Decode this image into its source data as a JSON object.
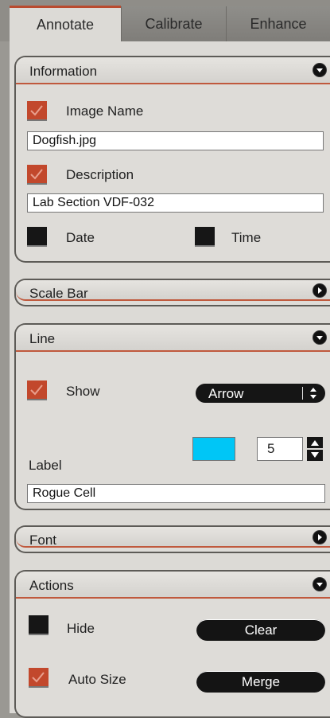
{
  "tabs": [
    {
      "label": "Annotate",
      "active": true
    },
    {
      "label": "Calibrate",
      "active": false
    },
    {
      "label": "Enhance",
      "active": false
    }
  ],
  "information": {
    "title": "Information",
    "image_name": {
      "label": "Image Name",
      "checked": true,
      "value": "Dogfish.jpg"
    },
    "description": {
      "label": "Description",
      "checked": true,
      "value": "Lab Section VDF-032"
    },
    "date": {
      "label": "Date",
      "checked": false
    },
    "time": {
      "label": "Time",
      "checked": false
    }
  },
  "scale_bar": {
    "title": "Scale Bar"
  },
  "line": {
    "title": "Line",
    "show": {
      "label": "Show",
      "checked": true
    },
    "style": {
      "value": "Arrow"
    },
    "color": "#00c6f6",
    "width": {
      "value": "5"
    },
    "label_text": {
      "label": "Label",
      "value": "Rogue Cell"
    }
  },
  "font": {
    "title": "Font"
  },
  "actions": {
    "title": "Actions",
    "hide": {
      "label": "Hide",
      "checked": false
    },
    "auto_size": {
      "label": "Auto Size",
      "checked": true
    },
    "clear_label": "Clear",
    "merge_label": "Merge"
  },
  "colors": {
    "accent": "#c2482c",
    "panel": "#dedcd8",
    "background": "#9a9893"
  }
}
